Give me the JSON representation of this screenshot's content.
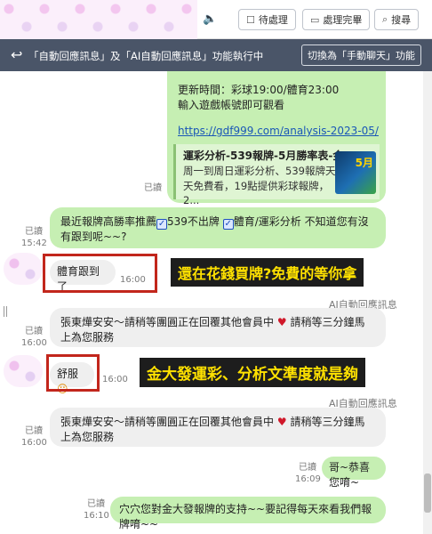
{
  "topbar": {
    "buttons": [
      {
        "label": "待處理",
        "icon": "☐"
      },
      {
        "label": "處理完畢",
        "icon": "☐"
      },
      {
        "label": "搜尋",
        "icon": "🔍"
      }
    ]
  },
  "statusbar": {
    "text": "「自動回應訊息」及「AI自動回應訊息」功能執行中",
    "switch_label": "切換為「手動聊天」功能"
  },
  "chat": {
    "msg1": {
      "line1": "更新時間：彩球19:00/體育23:00",
      "line2": "輸入遊戲帳號即可觀看",
      "link": "https://gdf999.com/analysis-2023-05/",
      "preview_title": "運彩分析-539報牌-5月勝率表-金...",
      "preview_desc": "周一到周日運彩分析、539報牌天天免費看，19點提供彩球報牌，2...",
      "thumb_text": "5月",
      "read": "已讀"
    },
    "msg2": {
      "part1": "最近報牌高勝率推薦",
      "part2": "539不出牌",
      "part3": "體育/運彩分析 不知道您有沒有跟到呢~~?",
      "read": "已讀",
      "time": "15:42"
    },
    "msg3": {
      "text": "體育跟到了",
      "time": "16:00"
    },
    "banner1": "還在花錢買牌?免費的等你拿",
    "ai_label_1": "AI自動回應訊息",
    "msg4": {
      "text_a": "張東燁安安～請稍等團圓正在回覆其他會員中",
      "text_b": "請稍等三分鐘馬上為您服務",
      "read": "已讀",
      "time": "16:00"
    },
    "msg5": {
      "text": "舒服",
      "time": "16:00"
    },
    "banner2": "金大發運彩、分析文準度就是夠",
    "ai_label_2": "AI自動回應訊息",
    "msg6": {
      "text_a": "張東燁安安～請稍等團圓正在回覆其他會員中",
      "text_b": "請稍等三分鐘馬上為您服務",
      "read": "已讀",
      "time": "16:00"
    },
    "msg7": {
      "text": "哥~恭喜您唷~",
      "read": "已讀",
      "time": "16:09"
    },
    "msg8": {
      "text": "穴穴您對金大發報牌的支持~~要記得每天來看我們報牌唷~~",
      "read": "已讀",
      "time": "16:10"
    }
  },
  "colors": {
    "green_bubble": "#c6efb3",
    "status_bar": "#4a5568",
    "highlight": "#c2261c",
    "banner_text": "#ffe100"
  }
}
